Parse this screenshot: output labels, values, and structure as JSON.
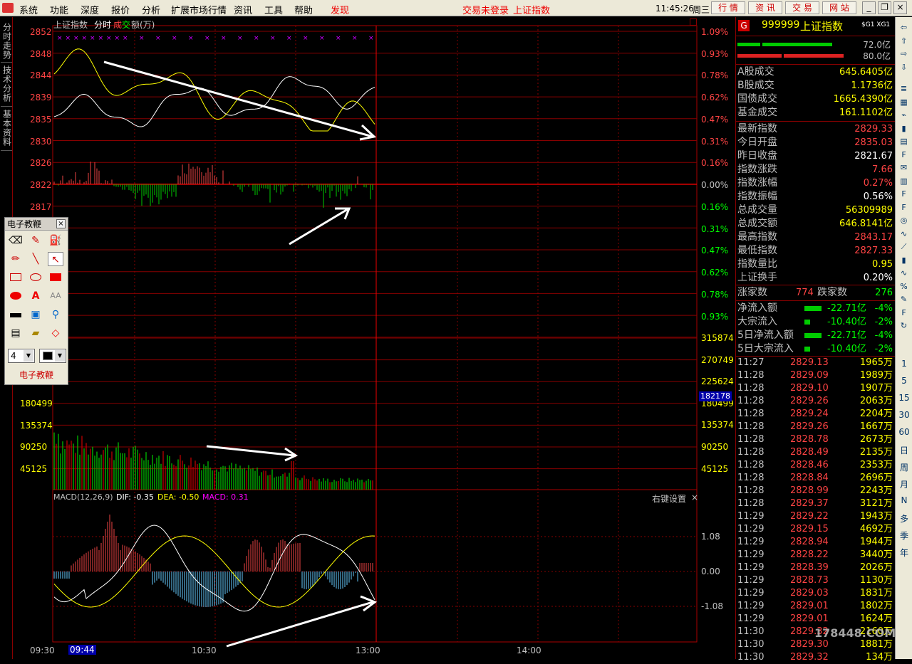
{
  "menu": {
    "items": [
      "系统",
      "功能",
      "深度",
      "报价",
      "分析",
      "扩展市场行情",
      "资讯",
      "工具",
      "帮助"
    ],
    "discover": "发现",
    "trade_status": "交易未登录",
    "index_name": "上证指数",
    "time": "11:45:26",
    "weekday": "周三",
    "quick_buttons": [
      "行 情",
      "资 讯",
      "交 易",
      "网 站"
    ]
  },
  "left_tabs": [
    "分时走势",
    "技术分析",
    "基本资料"
  ],
  "chart": {
    "title": "上证指数",
    "mode_label": "分时",
    "volume_label_a": "成",
    "volume_label_b": "交",
    "volume_label_c": "额(万)",
    "price_axis": [
      "2852",
      "2848",
      "2844",
      "2839",
      "2835",
      "2830",
      "2826",
      "2822",
      "2817"
    ],
    "pct_axis_up": [
      "1.09%",
      "0.93%",
      "0.78%",
      "0.62%",
      "0.47%",
      "0.31%",
      "0.16%",
      "0.00%"
    ],
    "pct_axis_down": [
      "0.16%",
      "0.31%",
      "0.47%",
      "0.62%",
      "0.78%",
      "0.93%"
    ],
    "vol_axis": [
      "315874",
      "270749",
      "225624",
      "180499",
      "135374",
      "90250",
      "45125"
    ],
    "vol_axis_left": [
      "180499",
      "135374",
      "90250",
      "45125"
    ],
    "vol_marker": "182178",
    "macd_title": "MACD(12,26,9)",
    "macd_dif": "DIF: -0.35",
    "macd_dea": "DEA: -0.50",
    "macd_val": "MACD: 0.31",
    "macd_settings": "右键设置",
    "macd_axis": [
      "1.08",
      "0.00",
      "-1.08"
    ],
    "time_axis": [
      "09:30",
      "09:44",
      "10:30",
      "13:00",
      "14:00"
    ]
  },
  "toolbox": {
    "title": "电子教鞭",
    "line_width": "4",
    "footer": "电子教鞭"
  },
  "quote": {
    "badge": "G",
    "code": "999999",
    "name": "上证指数",
    "tags": "$G1 XG1",
    "bar_top_value": "72.0亿",
    "bar_bottom_value": "80.0亿",
    "rows_a": [
      {
        "label": "A股成交",
        "value": "645.6405亿"
      },
      {
        "label": "B股成交",
        "value": "1.1736亿"
      },
      {
        "label": "国债成交",
        "value": "1665.4390亿"
      },
      {
        "label": "基金成交",
        "value": "161.1102亿"
      }
    ],
    "rows_b": [
      {
        "label": "最新指数",
        "value": "2829.33",
        "color": "#f44"
      },
      {
        "label": "今日开盘",
        "value": "2835.03",
        "color": "#f44"
      },
      {
        "label": "昨日收盘",
        "value": "2821.67",
        "color": "#fff"
      },
      {
        "label": "指数涨跌",
        "value": "7.66",
        "color": "#f44"
      },
      {
        "label": "指数涨幅",
        "value": "0.27%",
        "color": "#f44"
      },
      {
        "label": "指数振幅",
        "value": "0.56%",
        "color": "#fff"
      },
      {
        "label": "总成交量",
        "value": "56309989",
        "color": "#ff0"
      },
      {
        "label": "总成交额",
        "value": "646.8141亿",
        "color": "#ff0"
      },
      {
        "label": "最高指数",
        "value": "2843.17",
        "color": "#f44"
      },
      {
        "label": "最低指数",
        "value": "2827.33",
        "color": "#f44"
      },
      {
        "label": "指数量比",
        "value": "0.95",
        "color": "#ff0"
      },
      {
        "label": "上证换手",
        "value": "0.20%",
        "color": "#fff"
      }
    ],
    "up_label": "涨家数",
    "up_count": "774",
    "down_label": "跌家数",
    "down_count": "276",
    "flows": [
      {
        "label": "净流入额",
        "value": "-22.71亿",
        "pct": "-4%"
      },
      {
        "label": "大宗流入",
        "value": "-10.40亿",
        "pct": "-2%"
      },
      {
        "label": "5日净流入额",
        "value": "-22.71亿",
        "pct": "-4%"
      },
      {
        "label": "5日大宗流入",
        "value": "-10.40亿",
        "pct": "-2%"
      }
    ],
    "ticks": [
      [
        "11:27",
        "2829.13",
        "1965万"
      ],
      [
        "11:28",
        "2829.09",
        "1989万"
      ],
      [
        "11:28",
        "2829.10",
        "1907万"
      ],
      [
        "11:28",
        "2829.26",
        "2063万"
      ],
      [
        "11:28",
        "2829.24",
        "2204万"
      ],
      [
        "11:28",
        "2829.26",
        "1667万"
      ],
      [
        "11:28",
        "2828.78",
        "2673万"
      ],
      [
        "11:28",
        "2828.49",
        "2135万"
      ],
      [
        "11:28",
        "2828.46",
        "2353万"
      ],
      [
        "11:28",
        "2828.84",
        "2696万"
      ],
      [
        "11:28",
        "2828.99",
        "2243万"
      ],
      [
        "11:28",
        "2829.37",
        "3121万"
      ],
      [
        "11:29",
        "2829.22",
        "1943万"
      ],
      [
        "11:29",
        "2829.15",
        "4692万"
      ],
      [
        "11:29",
        "2828.94",
        "1944万"
      ],
      [
        "11:29",
        "2828.22",
        "3440万"
      ],
      [
        "11:29",
        "2828.39",
        "2026万"
      ],
      [
        "11:29",
        "2828.73",
        "1130万"
      ],
      [
        "11:29",
        "2829.03",
        "1831万"
      ],
      [
        "11:29",
        "2829.01",
        "1802万"
      ],
      [
        "11:29",
        "2829.01",
        "1624万"
      ],
      [
        "11:30",
        "2829.32",
        "2160万"
      ],
      [
        "11:30",
        "2829.30",
        "1881万"
      ],
      [
        "11:30",
        "2829.32",
        "134万"
      ]
    ]
  },
  "sidebar_periods": [
    "1",
    "5",
    "15",
    "30",
    "60",
    "日",
    "周",
    "月",
    "N",
    "多",
    "季",
    "年"
  ],
  "watermark": "178448.COM"
}
